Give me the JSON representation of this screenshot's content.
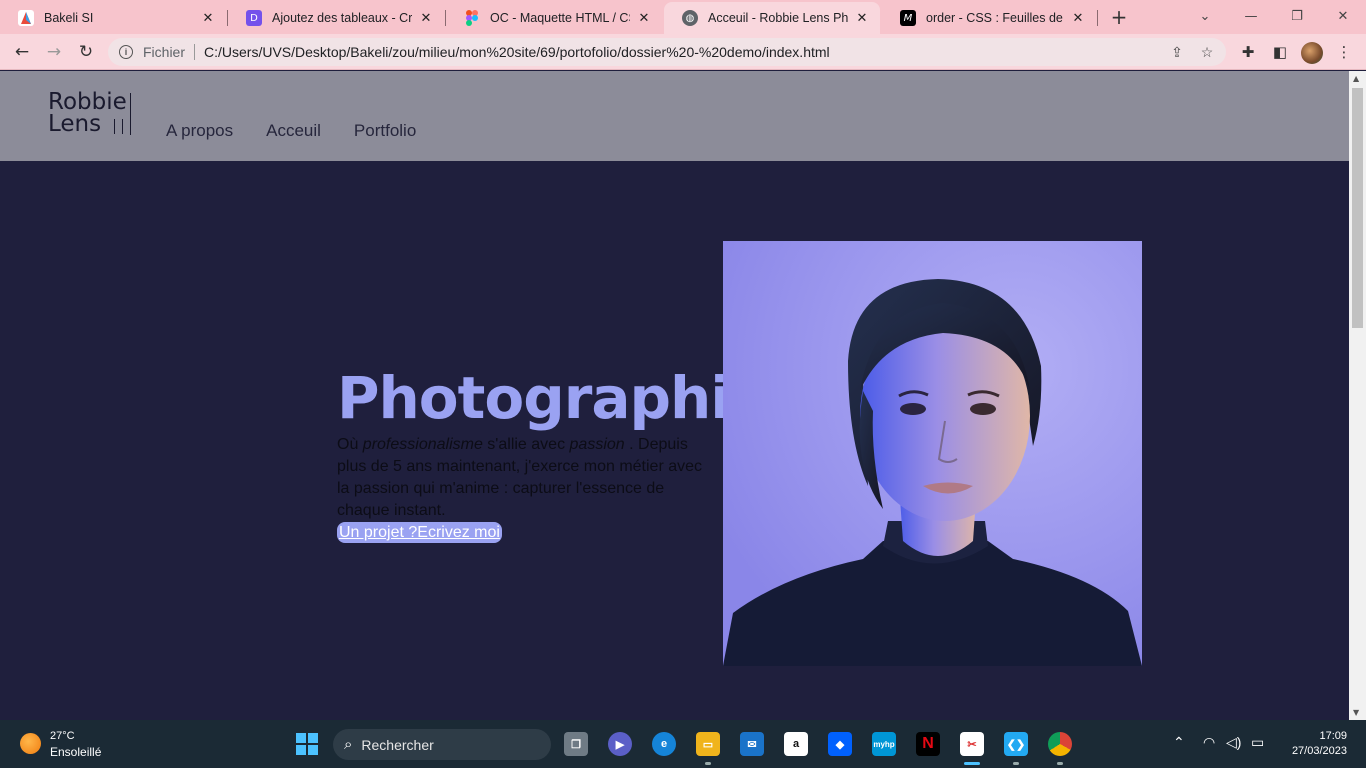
{
  "browser": {
    "tabs": [
      {
        "title": "Bakeli SI",
        "favicon": "bakeli-icon",
        "color": "#e94b3c"
      },
      {
        "title": "Ajoutez des tableaux - Créez",
        "favicon": "openclassrooms-icon",
        "color": "#7451eb"
      },
      {
        "title": "OC - Maquette HTML / CSS d",
        "favicon": "figma-icon",
        "color": "#1e1e1e"
      },
      {
        "title": "Acceuil - Robbie Lens Photog",
        "favicon": "globe-icon",
        "color": "#5f6368"
      },
      {
        "title": "order - CSS : Feuilles de style",
        "favicon": "mdn-icon",
        "color": "#000000"
      }
    ],
    "address": {
      "scheme_label": "Fichier",
      "url": "C:/Users/UVS/Desktop/Bakeli/zou/milieu/mon%20site/69/portofolio/dossier%20-%20demo/index.html"
    }
  },
  "site": {
    "logo": {
      "line1": "Robbie",
      "line2": "Lens"
    },
    "nav": [
      "A propos",
      "Acceuil",
      "Portfolio"
    ],
    "hero": {
      "title": "Photographie",
      "text_prefix": "Où ",
      "em1": "professionalisme",
      "text_mid": " s'allie avec ",
      "em2": "passion",
      "text_suffix": " . Depuis plus de 5 ans maintenant, j'exerce mon métier avec la passion qui m'anime : capturer l'essence de chaque instant.",
      "cta": "Un projet ?Ecrivez moi"
    },
    "colors": {
      "accent": "#9aa2f2",
      "background": "#1f1f3d",
      "header": "#8c8c99"
    }
  },
  "taskbar": {
    "weather": {
      "temp": "27°C",
      "desc": "Ensoleillé"
    },
    "search_placeholder": "Rechercher",
    "time": "17:09",
    "date": "27/03/2023"
  }
}
